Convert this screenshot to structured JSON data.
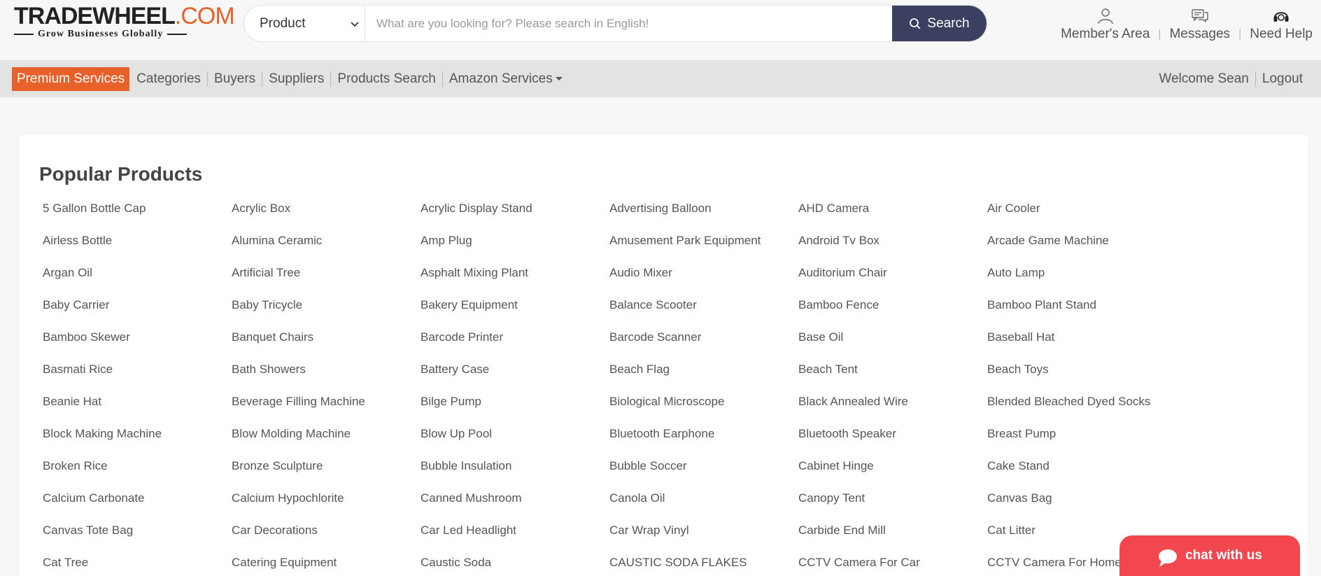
{
  "logo": {
    "trade": "TRADE",
    "wheel": "WHEEL",
    "dotcom": ".COM",
    "tagline": "Grow Businesses Globally"
  },
  "search": {
    "category": "Product",
    "placeholder": "What are you looking for? Please search in English!",
    "button_label": "Search"
  },
  "top_links": {
    "members": "Member's Area",
    "messages": "Messages",
    "help": "Need Help"
  },
  "nav": {
    "premium": "Premium Services",
    "categories": "Categories",
    "buyers": "Buyers",
    "suppliers": "Suppliers",
    "products_search": "Products Search",
    "amazon": "Amazon Services",
    "welcome": "Welcome Sean",
    "logout": "Logout"
  },
  "main": {
    "title": "Popular Products",
    "products": [
      "5 Gallon Bottle Cap",
      "Acrylic Box",
      "Acrylic Display Stand",
      "Advertising Balloon",
      "AHD Camera",
      "Air Cooler",
      "Airless Bottle",
      "Alumina Ceramic",
      "Amp Plug",
      "Amusement Park Equipment",
      "Android Tv Box",
      "Arcade Game Machine",
      "Argan Oil",
      "Artificial Tree",
      "Asphalt Mixing Plant",
      "Audio Mixer",
      "Auditorium Chair",
      "Auto Lamp",
      "Baby Carrier",
      "Baby Tricycle",
      "Bakery Equipment",
      "Balance Scooter",
      "Bamboo Fence",
      "Bamboo Plant Stand",
      "Bamboo Skewer",
      "Banquet Chairs",
      "Barcode Printer",
      "Barcode Scanner",
      "Base Oil",
      "Baseball Hat",
      "Basmati Rice",
      "Bath Showers",
      "Battery Case",
      "Beach Flag",
      "Beach Tent",
      "Beach Toys",
      "Beanie Hat",
      "Beverage Filling Machine",
      "Bilge Pump",
      "Biological Microscope",
      "Black Annealed Wire",
      "Blended Bleached Dyed Socks",
      "Block Making Machine",
      "Blow Molding Machine",
      "Blow Up Pool",
      "Bluetooth Earphone",
      "Bluetooth Speaker",
      "Breast Pump",
      "Broken Rice",
      "Bronze Sculpture",
      "Bubble Insulation",
      "Bubble Soccer",
      "Cabinet Hinge",
      "Cake Stand",
      "Calcium Carbonate",
      "Calcium Hypochlorite",
      "Canned Mushroom",
      "Canola Oil",
      "Canopy Tent",
      "Canvas Bag",
      "Canvas Tote Bag",
      "Car Decorations",
      "Car Led Headlight",
      "Car Wrap Vinyl",
      "Carbide End Mill",
      "Cat Litter",
      "Cat Tree",
      "Catering Equipment",
      "Caustic Soda",
      "CAUSTIC SODA FLAKES",
      "CCTV Camera For Car",
      "CCTV Camera For Home"
    ]
  },
  "chat": {
    "label": "chat with us"
  },
  "colors": {
    "brand_orange": "#e8602a",
    "search_button": "#3b4060",
    "chat_red": "#f2474f"
  }
}
